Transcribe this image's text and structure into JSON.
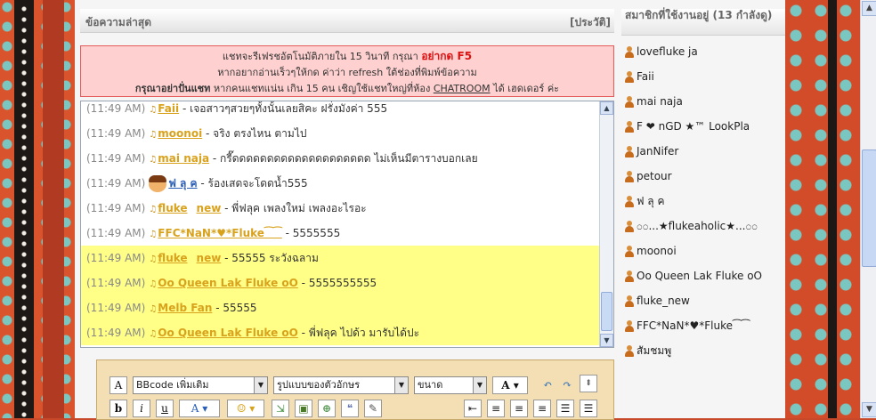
{
  "chat_panel": {
    "title": "ข้อความล่าสุด",
    "history_link": "[ประวัติ]"
  },
  "notice": {
    "line1_prefix": "แชทจะรีเฟรชอัตโนมัติภายใน 15 วินาที กรุณา",
    "line1_emph": "อย่ากด F5",
    "line2": "หากอยากอ่านเร็วๆให้กด ค่าว่า refresh ใต้ช่องที่พิมพ์ข้อความ",
    "line3_bold": "กรุณาอย่าปั่นแชท",
    "line3_rest": "หากคนแชทแน่น เกิน 15 คน เชิญใช้แชทใหญ่ที่ห้อง",
    "line3_link": "CHATROOM",
    "line3_end": "ได้ เฮดเดอร์ ค่ะ"
  },
  "messages": [
    {
      "time": "(11:49 AM)",
      "user": "Faii",
      "user2": "",
      "text": "- เจอสาวๆสวยๆทั้งนั้นเลยสิคะ ฝรั่งมังค่า 555",
      "highlight": false
    },
    {
      "time": "(11:49 AM)",
      "user": "moonoi",
      "user2": "",
      "text": "- จริง ตรงไหน ตามไป",
      "highlight": false
    },
    {
      "time": "(11:49 AM)",
      "user": "mai naja",
      "user2": "",
      "text": "- กรี๊ดดดดดดดดดดดดดดดดดดดด ไม่เห็นมีตารางบอกเลย",
      "highlight": false
    },
    {
      "time": "(11:49 AM)",
      "user": "ฟ ลุ ค",
      "user2": "",
      "text": "- ร้องเสดจะโดดน้ำ555",
      "highlight": false
    },
    {
      "time": "(11:49 AM)",
      "user": "fluke",
      "user2": "new",
      "text": "- พี่ฟลุค เพลงใหม่ เพลงอะไรอะ",
      "highlight": false
    },
    {
      "time": "(11:49 AM)",
      "user": "FFC*NaN*♥*Fluke⁀⁀",
      "user2": "",
      "text": "- 5555555",
      "highlight": false
    },
    {
      "time": "(11:49 AM)",
      "user": "fluke",
      "user2": "new",
      "text": "- 55555 ระวังฉลาม",
      "highlight": true
    },
    {
      "time": "(11:49 AM)",
      "user": "Oo Queen Lak Fluke oO",
      "user2": "",
      "text": "- 5555555555",
      "highlight": true
    },
    {
      "time": "(11:49 AM)",
      "user": "Melb Fan",
      "user2": "",
      "text": "- 55555",
      "highlight": true
    },
    {
      "time": "(11:49 AM)",
      "user": "Oo Queen Lak Fluke oO",
      "user2": "",
      "text": "- พี่ฟลุค ไปด้ว มารับได้ปะ",
      "highlight": true
    }
  ],
  "toolbar": {
    "bbcode_select": "BBcode เพิ่มเติม",
    "font_select": "รูปแบบของตัวอักษร",
    "size_select": "ขนาด",
    "bold": "b",
    "italic": "i",
    "underline": "u",
    "font_color": "A"
  },
  "members_panel": {
    "title": "สมาชิกที่ใช้งานอยู่ (13 กำลังดู)",
    "members": [
      "lovefluke ja",
      "Faii",
      "mai naja",
      "F ❤ nGD ★™ LookPla",
      "JanNifer",
      "petour",
      "ฟ ลุ ค",
      "೦೦...★flukeaholic★...೦೦",
      "moonoi",
      "Oo Queen Lak Fluke oO",
      "fluke_new",
      "FFC*NaN*♥*Fluke⁀⁀",
      "สัมชมพู"
    ]
  }
}
